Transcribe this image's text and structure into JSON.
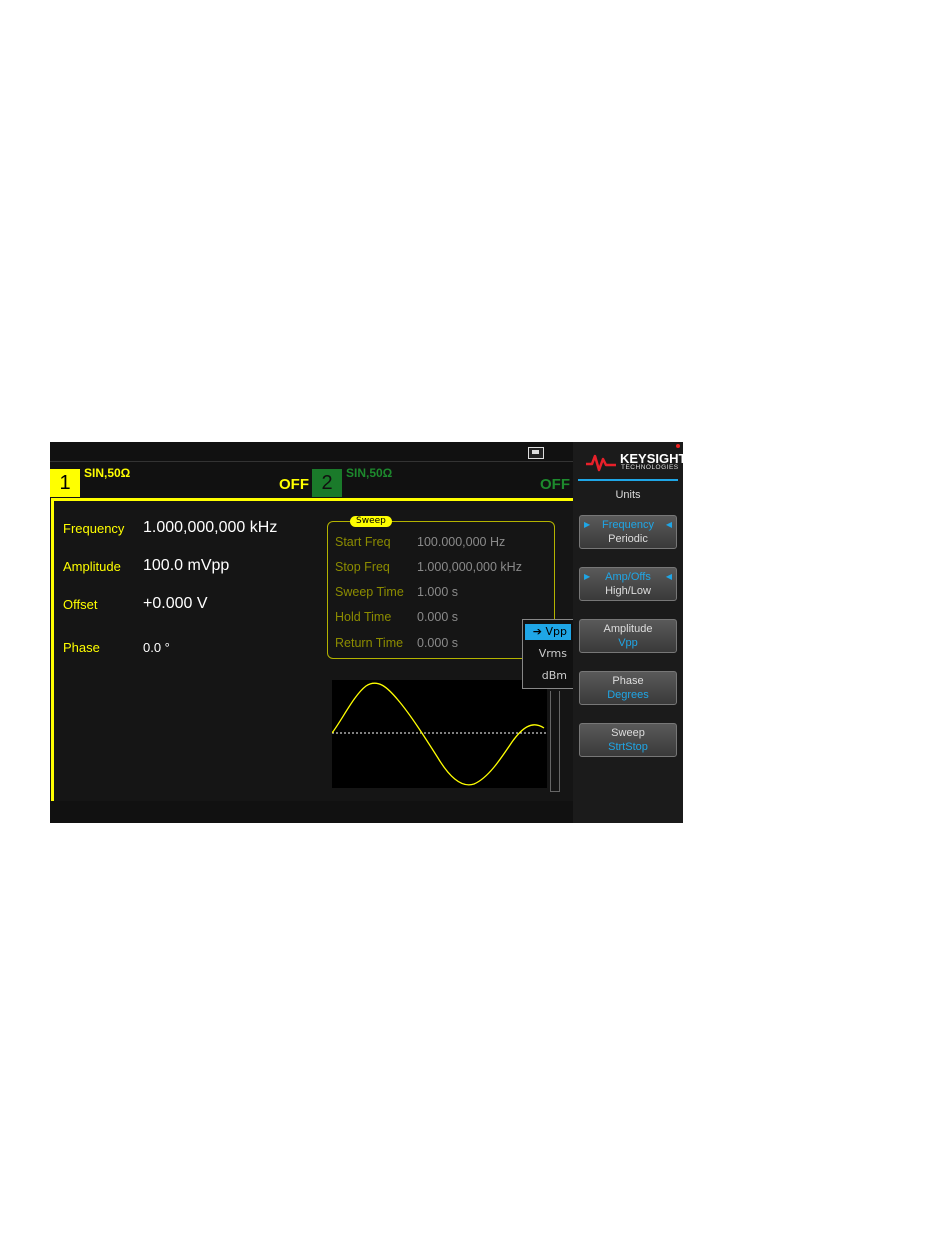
{
  "channel1": {
    "number": "1",
    "label": "SIN,50Ω",
    "state": "OFF"
  },
  "channel2": {
    "number": "2",
    "label": "SIN,50Ω",
    "state": "OFF"
  },
  "params": [
    {
      "label": "Frequency",
      "value": "1.000,000,000 kHz"
    },
    {
      "label": "Amplitude",
      "value": "100.0 mVpp"
    },
    {
      "label": "Offset",
      "value": "+0.000 V"
    },
    {
      "label": "Phase",
      "value": "0.0 °"
    }
  ],
  "sweep": {
    "tag": "Sweep",
    "rows": [
      {
        "label": "Start Freq",
        "value": "100.000,000 Hz"
      },
      {
        "label": "Stop Freq",
        "value": "1.000,000,000 kHz"
      },
      {
        "label": "Sweep Time",
        "value": "1.000 s"
      },
      {
        "label": "Hold Time",
        "value": "0.000 s"
      },
      {
        "label": "Return Time",
        "value": "0.000 s"
      }
    ]
  },
  "units_dropdown": {
    "options": [
      "Vpp",
      "Vrms",
      "dBm"
    ],
    "selected_marker": "➔"
  },
  "brand": {
    "name": "KEYSIGHT",
    "sub": "TECHNOLOGIES"
  },
  "softkeys": {
    "title": "Units",
    "keys": [
      {
        "line1": "Frequency",
        "line2": "Periodic"
      },
      {
        "line1": "Amp/Offs",
        "line2": "High/Low"
      },
      {
        "line1": "Amplitude",
        "line2": "Vpp"
      },
      {
        "line1": "Phase",
        "line2": "Degrees"
      },
      {
        "line1": "Sweep",
        "line2": "StrtStop"
      }
    ]
  },
  "colors": {
    "ch1": "#ffff00",
    "ch2": "#1d8a2d",
    "accent": "#1fa6e6",
    "logo": "#e8202a"
  }
}
